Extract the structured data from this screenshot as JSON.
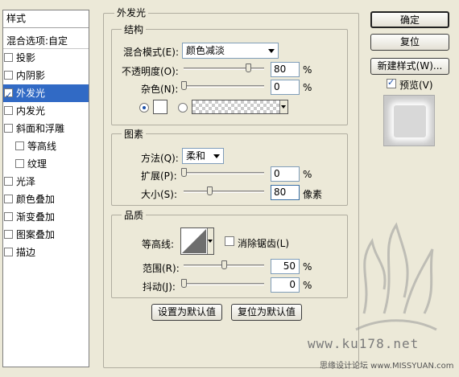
{
  "style_panel": {
    "header": "样式",
    "blend_options": "混合选项:自定",
    "items": [
      {
        "label": "投影",
        "checked": false,
        "indent": false,
        "selected": false
      },
      {
        "label": "内阴影",
        "checked": false,
        "indent": false,
        "selected": false
      },
      {
        "label": "外发光",
        "checked": true,
        "indent": false,
        "selected": true
      },
      {
        "label": "内发光",
        "checked": false,
        "indent": false,
        "selected": false
      },
      {
        "label": "斜面和浮雕",
        "checked": false,
        "indent": false,
        "selected": false
      },
      {
        "label": "等高线",
        "checked": false,
        "indent": true,
        "selected": false
      },
      {
        "label": "纹理",
        "checked": false,
        "indent": true,
        "selected": false
      },
      {
        "label": "光泽",
        "checked": false,
        "indent": false,
        "selected": false
      },
      {
        "label": "颜色叠加",
        "checked": false,
        "indent": false,
        "selected": false
      },
      {
        "label": "渐变叠加",
        "checked": false,
        "indent": false,
        "selected": false
      },
      {
        "label": "图案叠加",
        "checked": false,
        "indent": false,
        "selected": false
      },
      {
        "label": "描边",
        "checked": false,
        "indent": false,
        "selected": false
      }
    ]
  },
  "outer_glow": {
    "title": "外发光",
    "structure": {
      "title": "结构",
      "blend_mode_label": "混合模式(E):",
      "blend_mode_value": "颜色减淡",
      "opacity_label": "不透明度(O):",
      "opacity_value": "80",
      "opacity_level": 80,
      "noise_label": "杂色(N):",
      "noise_value": "0",
      "noise_level": 0,
      "percent": "%"
    },
    "elements": {
      "title": "图素",
      "technique_label": "方法(Q):",
      "technique_value": "柔和",
      "spread_label": "扩展(P):",
      "spread_value": "0",
      "spread_level": 0,
      "size_label": "大小(S):",
      "size_value": "80",
      "size_level": 0.32,
      "percent": "%",
      "px_unit": "像素"
    },
    "quality": {
      "title": "品质",
      "contour_label": "等高线:",
      "anti_alias_label": "消除锯齿(L)",
      "range_label": "范围(R):",
      "range_value": "50",
      "range_level": 50,
      "jitter_label": "抖动(J):",
      "jitter_value": "0",
      "jitter_level": 0,
      "percent": "%"
    },
    "set_default": "设置为默认值",
    "reset_default": "复位为默认值"
  },
  "buttons": {
    "ok": "确定",
    "reset": "复位",
    "new_style": "新建样式(W)...",
    "preview_label": "预览(V)",
    "preview_checked": true
  },
  "watermark": {
    "site": "www.ku178.net",
    "footer": "思缘设计论坛 www.MISSYUAN.com"
  },
  "colors": {
    "selection": "#316ac5",
    "dialog_bg": "#ece9d8"
  }
}
